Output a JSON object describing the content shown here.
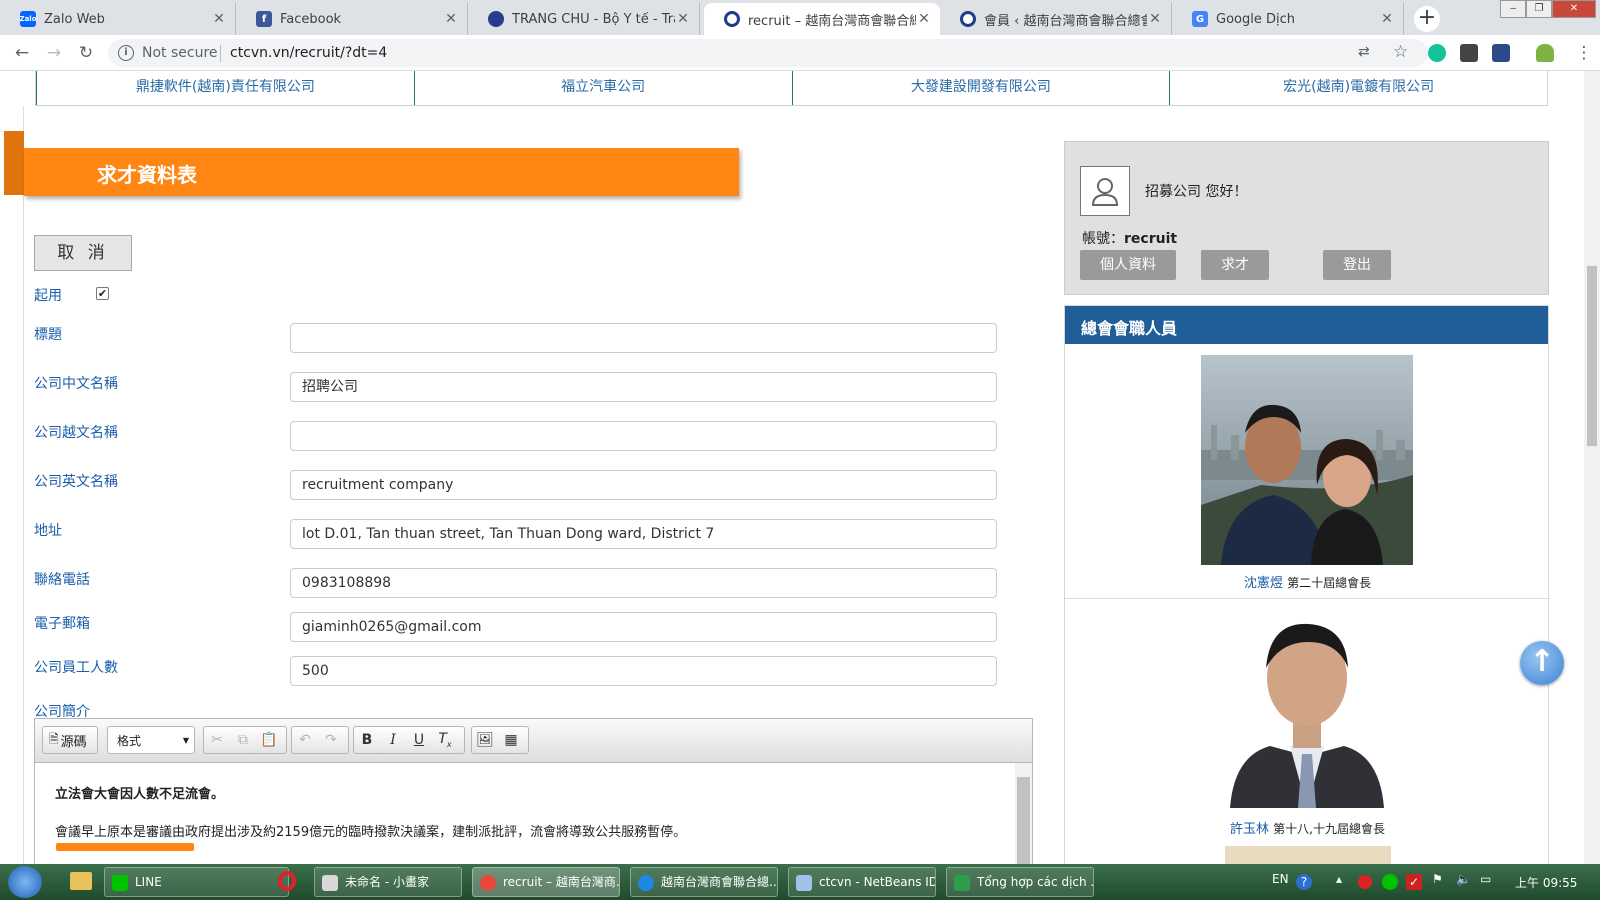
{
  "browser": {
    "tabs": [
      {
        "label": "Zalo Web",
        "favicon_text": "Zalo",
        "color": "#0068ff",
        "active": false
      },
      {
        "label": "Facebook",
        "favicon_text": "f",
        "color": "#3b5998",
        "active": false
      },
      {
        "label": "TRANG CHỦ - Bộ Y tế - Trang t",
        "favicon_text": "",
        "color": "#2a3a8c",
        "active": false
      },
      {
        "label": "recruit – 越南台灣商會聯合總會",
        "favicon_text": "",
        "color": "#1f3c88",
        "active": true
      },
      {
        "label": "會員 ‹ 越南台灣商會聯合總會 —",
        "favicon_text": "",
        "color": "#1f3c88",
        "active": false
      },
      {
        "label": "Google Dịch",
        "favicon_text": "G",
        "color": "#4285f4",
        "active": false
      }
    ],
    "new_tab_label": "+",
    "not_secure_label": "Not secure",
    "url": "ctcvn.vn/recruit/?dt=4"
  },
  "company_links": [
    "鼎捷軟件(越南)責任有限公司",
    "福立汽車公司",
    "大發建設開發有限公司",
    "宏光(越南)電鍍有限公司"
  ],
  "page": {
    "banner_title": "求才資料表",
    "cancel_label": "取 消",
    "enable_label": "起用",
    "enable_checked": true
  },
  "form": {
    "title": {
      "label": "標題",
      "value": ""
    },
    "company_cn": {
      "label": "公司中文名稱",
      "value": "招聘公司"
    },
    "company_vn": {
      "label": "公司越文名稱",
      "value": ""
    },
    "company_en": {
      "label": "公司英文名稱",
      "value": "recruitment company"
    },
    "address": {
      "label": "地址",
      "value": "lot D.01, Tan thuan street, Tan Thuan Dong ward, District 7"
    },
    "phone": {
      "label": "聯絡電話",
      "value": "0983108898"
    },
    "email": {
      "label": "電子郵箱",
      "value": "giaminh0265@gmail.com"
    },
    "employees": {
      "label": "公司員工人數",
      "value": "500"
    },
    "intro_label": "公司簡介"
  },
  "editor": {
    "source_label": "源碼",
    "format_label": "格式",
    "paragraph_1": "立法會大會因人數不足流會。",
    "paragraph_2": "會議早上原本是審議由政府提出涉及約2159億元的臨時撥款決議案，建制派批評，流會將導致公共服務暫停。"
  },
  "sidebar": {
    "greeting": "招募公司 您好！",
    "account_label": "帳號：",
    "account_value": "recruit",
    "buttons": [
      "個人資料",
      "求才",
      "登出"
    ],
    "staff_title": "總會會職人員",
    "staff": [
      {
        "name": "沈憲煜",
        "role": "第二十屆總會長"
      },
      {
        "name": "許玉林",
        "role": "第十八,十九屆總會長"
      }
    ]
  },
  "taskbar": {
    "items": [
      "LINE",
      "未命名 - 小畫家",
      "recruit – 越南台灣商...",
      "越南台灣商會聯合總...",
      "ctcvn - NetBeans ID...",
      "Tổng hợp các dịch ..."
    ],
    "language": "EN",
    "clock": "上午 09:55"
  }
}
